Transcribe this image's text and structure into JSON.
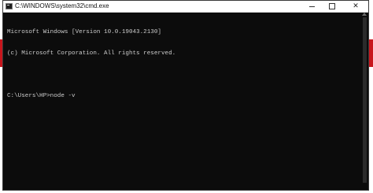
{
  "window": {
    "title": "C:\\WINDOWS\\system32\\cmd.exe",
    "controls": {
      "minimize": "",
      "maximize": "",
      "close": "✕"
    }
  },
  "console": {
    "lines": [
      "Microsoft Windows [Version 10.0.19043.2130]",
      "(c) Microsoft Corporation. All rights reserved.",
      "",
      "C:\\Users\\HP>node -v"
    ]
  },
  "colors": {
    "console_bg": "#0c0c0c",
    "console_text": "#cccccc",
    "titlebar_bg": "#ffffff",
    "desktop_red": "#c8161d"
  },
  "icons": {
    "app": "cmd-icon",
    "minimize": "minimize-icon",
    "maximize": "maximize-icon",
    "close": "close-icon"
  }
}
